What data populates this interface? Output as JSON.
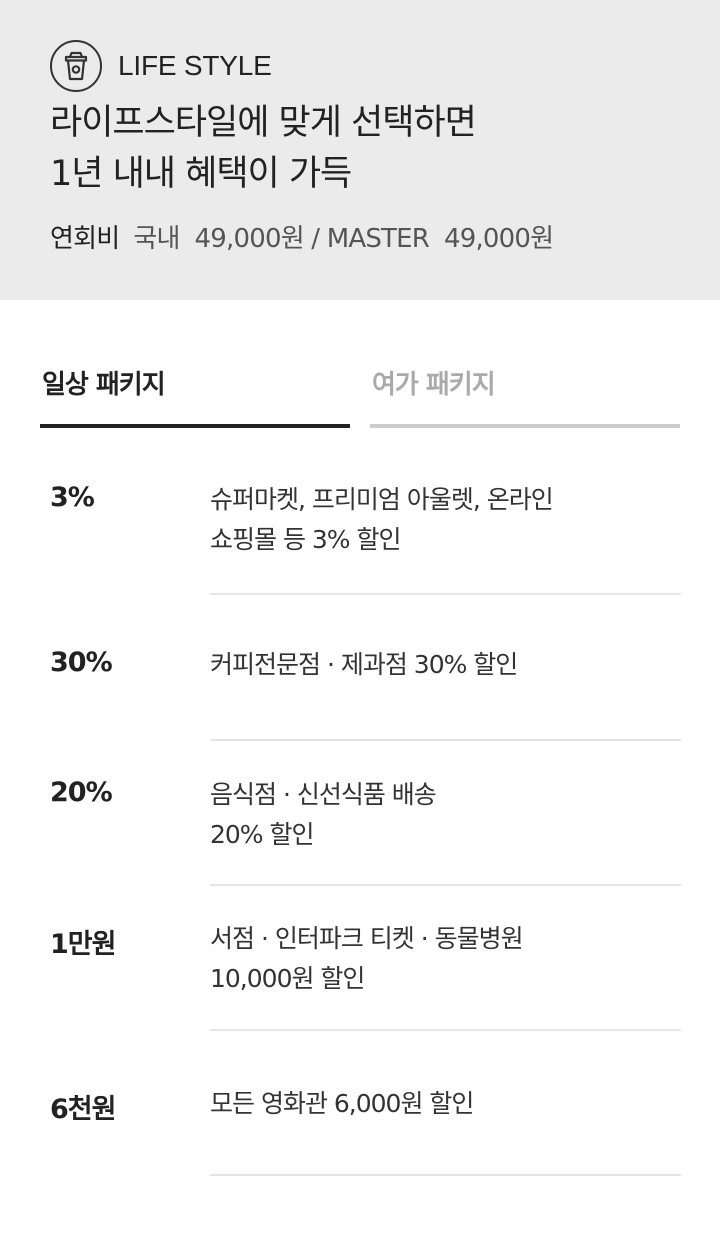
{
  "header": {
    "category_icon": "coffee-cup-icon",
    "category_label": "LIFE STYLE",
    "headline_line1": "라이프스타일에 맞게 선택하면",
    "headline_line2": "1년 내내 혜택이 가득",
    "fee_label": "연회비",
    "fee_values": "국내  49,000원 / MASTER  49,000원",
    "background_color": "#ebebeb"
  },
  "tabs": [
    {
      "label": "일상 패키지",
      "active": true
    },
    {
      "label": "여가 패키지",
      "active": false
    }
  ],
  "benefits": [
    {
      "value": "3%",
      "lines": [
        "슈퍼마켓, 프리미엄 아울렛, 온라인",
        "쇼핑몰 등 3% 할인"
      ]
    },
    {
      "value": "30%",
      "lines": [
        "커피전문점 · 제과점 30% 할인"
      ]
    },
    {
      "value": "20%",
      "lines": [
        "음식점 · 신선식품 배송",
        "20% 할인"
      ]
    },
    {
      "value": "1만원",
      "lines": [
        "서점 · 인터파크 티켓 · 동물병원",
        "10,000원 할인"
      ]
    },
    {
      "value": "6천원",
      "lines": [
        "모든 영화관 6,000원 할인"
      ]
    }
  ]
}
